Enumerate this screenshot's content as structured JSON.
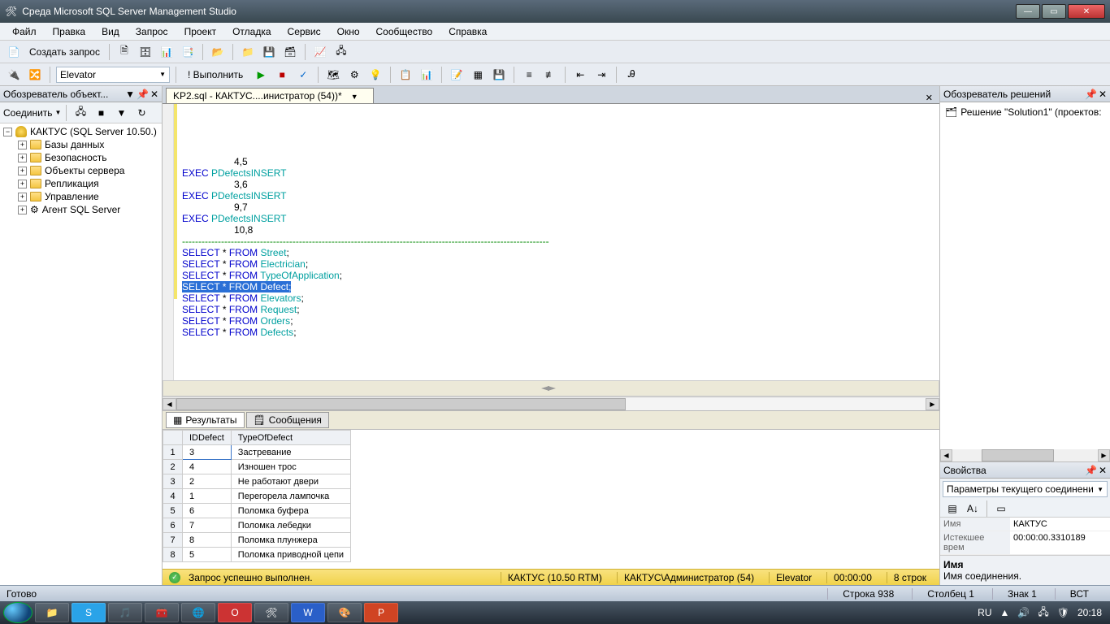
{
  "window": {
    "title": "Среда Microsoft SQL Server Management Studio"
  },
  "menu": [
    "Файл",
    "Правка",
    "Вид",
    "Запрос",
    "Проект",
    "Отладка",
    "Сервис",
    "Окно",
    "Сообщество",
    "Справка"
  ],
  "toolbar1": {
    "newQuery": "Создать запрос"
  },
  "toolbar2": {
    "dbCombo": "Elevator",
    "execute": "! Выполнить"
  },
  "objectExplorer": {
    "title": "Обозреватель объект...",
    "connect": "Соединить",
    "server": "КАКТУС (SQL Server 10.50.)",
    "nodes": [
      "Базы данных",
      "Безопасность",
      "Объекты сервера",
      "Репликация",
      "Управление",
      "Агент SQL Server"
    ]
  },
  "tab": {
    "label": "KP2.sql - КАКТУС....инистратор (54))*"
  },
  "editorLines": [
    {
      "indent": 8,
      "segs": [
        {
          "t": "4,5",
          "cls": ""
        }
      ]
    },
    {
      "indent": 0,
      "segs": [
        {
          "t": "EXEC ",
          "cls": "sql-kw"
        },
        {
          "t": "PDefectsINSERT",
          "cls": "sql-sp"
        }
      ]
    },
    {
      "indent": 8,
      "segs": [
        {
          "t": "3,6",
          "cls": ""
        }
      ]
    },
    {
      "indent": 0,
      "segs": [
        {
          "t": "EXEC ",
          "cls": "sql-kw"
        },
        {
          "t": "PDefectsINSERT",
          "cls": "sql-sp"
        }
      ]
    },
    {
      "indent": 8,
      "segs": [
        {
          "t": "9,7",
          "cls": ""
        }
      ]
    },
    {
      "indent": 0,
      "segs": [
        {
          "t": "EXEC ",
          "cls": "sql-kw"
        },
        {
          "t": "PDefectsINSERT",
          "cls": "sql-sp"
        }
      ]
    },
    {
      "indent": 8,
      "segs": [
        {
          "t": "10,8",
          "cls": ""
        }
      ]
    },
    {
      "indent": 0,
      "segs": [
        {
          "t": "",
          "cls": ""
        }
      ]
    },
    {
      "indent": 0,
      "segs": [
        {
          "t": "-----------------------------------------------------------------------------------------------------------------",
          "cls": "sql-comment"
        }
      ]
    },
    {
      "indent": 0,
      "segs": [
        {
          "t": "SELECT ",
          "cls": "sql-kw"
        },
        {
          "t": "* ",
          "cls": ""
        },
        {
          "t": "FROM ",
          "cls": "sql-kw"
        },
        {
          "t": "Street",
          "cls": "sql-sp"
        },
        {
          "t": ";",
          "cls": ""
        }
      ]
    },
    {
      "indent": 0,
      "segs": [
        {
          "t": "SELECT ",
          "cls": "sql-kw"
        },
        {
          "t": "* ",
          "cls": ""
        },
        {
          "t": "FROM ",
          "cls": "sql-kw"
        },
        {
          "t": "Electrician",
          "cls": "sql-sp"
        },
        {
          "t": ";",
          "cls": ""
        }
      ]
    },
    {
      "indent": 0,
      "segs": [
        {
          "t": "SELECT ",
          "cls": "sql-kw"
        },
        {
          "t": "* ",
          "cls": ""
        },
        {
          "t": "FROM ",
          "cls": "sql-kw"
        },
        {
          "t": "TypeOfApplication",
          "cls": "sql-sp"
        },
        {
          "t": ";",
          "cls": ""
        }
      ]
    },
    {
      "indent": 0,
      "segs": [
        {
          "t": "SELECT * FROM Defect;",
          "cls": "sql-hl"
        }
      ]
    },
    {
      "indent": 0,
      "segs": [
        {
          "t": "SELECT ",
          "cls": "sql-kw"
        },
        {
          "t": "* ",
          "cls": ""
        },
        {
          "t": "FROM ",
          "cls": "sql-kw"
        },
        {
          "t": "Elevators",
          "cls": "sql-sp"
        },
        {
          "t": ";",
          "cls": ""
        }
      ]
    },
    {
      "indent": 0,
      "segs": [
        {
          "t": "SELECT ",
          "cls": "sql-kw"
        },
        {
          "t": "* ",
          "cls": ""
        },
        {
          "t": "FROM ",
          "cls": "sql-kw"
        },
        {
          "t": "Request",
          "cls": "sql-sp"
        },
        {
          "t": ";",
          "cls": ""
        }
      ]
    },
    {
      "indent": 0,
      "segs": [
        {
          "t": "SELECT ",
          "cls": "sql-kw"
        },
        {
          "t": "* ",
          "cls": ""
        },
        {
          "t": "FROM ",
          "cls": "sql-kw"
        },
        {
          "t": "Orders",
          "cls": "sql-sp"
        },
        {
          "t": ";",
          "cls": ""
        }
      ]
    },
    {
      "indent": 0,
      "segs": [
        {
          "t": "SELECT ",
          "cls": "sql-kw"
        },
        {
          "t": "* ",
          "cls": ""
        },
        {
          "t": "FROM ",
          "cls": "sql-kw"
        },
        {
          "t": "Defects",
          "cls": "sql-sp"
        },
        {
          "t": ";",
          "cls": ""
        }
      ]
    }
  ],
  "resultTabs": {
    "results": "Результаты",
    "messages": "Сообщения"
  },
  "grid": {
    "headers": [
      "",
      "IDDefect",
      "TypeOfDefect"
    ],
    "rows": [
      [
        "1",
        "3",
        "Застревание"
      ],
      [
        "2",
        "4",
        "Изношен трос"
      ],
      [
        "3",
        "2",
        "Не работают двери"
      ],
      [
        "4",
        "1",
        "Перегорела лампочка"
      ],
      [
        "5",
        "6",
        "Поломка буфера"
      ],
      [
        "6",
        "7",
        "Поломка лебедки"
      ],
      [
        "7",
        "8",
        "Поломка плунжера"
      ],
      [
        "8",
        "5",
        "Поломка приводной цепи"
      ]
    ]
  },
  "queryStatus": {
    "ok": "Запрос успешно выполнен.",
    "server": "КАКТУС (10.50 RTM)",
    "user": "КАКТУС\\Администратор (54)",
    "db": "Elevator",
    "time": "00:00:00",
    "rows": "8 строк"
  },
  "solutionExplorer": {
    "title": "Обозреватель решений",
    "root": "Решение \"Solution1\" (проектов:"
  },
  "properties": {
    "title": "Свойства",
    "combo": "Параметры текущего соединения",
    "rows": [
      {
        "k": "Имя",
        "v": "КАКТУС"
      },
      {
        "k": "Истекшее врем",
        "v": "00:00:00.3310189"
      }
    ],
    "descTitle": "Имя",
    "descBody": "Имя соединения."
  },
  "status": {
    "ready": "Готово",
    "line": "Строка 938",
    "col": "Столбец 1",
    "char": "Знак 1",
    "ins": "ВСТ"
  },
  "taskbar": {
    "lang": "RU",
    "time": "20:18"
  }
}
